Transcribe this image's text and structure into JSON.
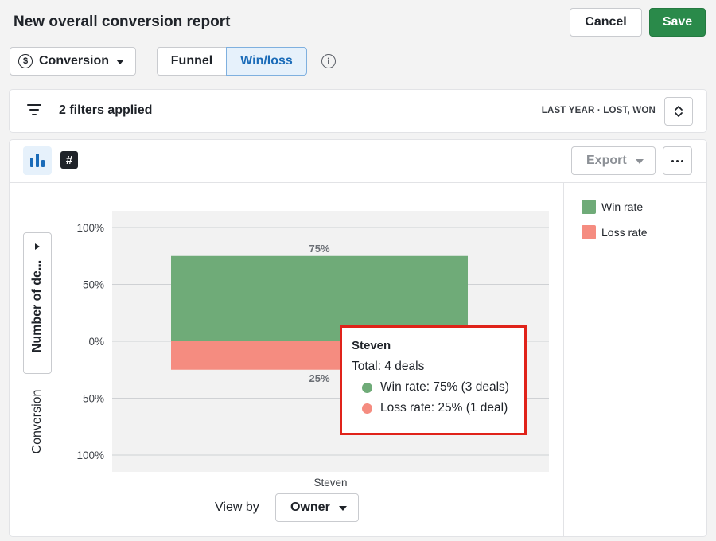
{
  "header": {
    "title": "New overall conversion report",
    "cancel_label": "Cancel",
    "save_label": "Save"
  },
  "toolbar": {
    "report_type": "Conversion",
    "segments": [
      "Funnel",
      "Win/loss"
    ],
    "active_segment": "Win/loss"
  },
  "filters": {
    "label": "2 filters applied",
    "summary": "LAST YEAR  ·  LOST, WON"
  },
  "panel": {
    "export_label": "Export",
    "vertical_dropdown_label": "Number of de...",
    "vertical_axis_label": "Conversion",
    "view_by_label": "View by",
    "view_by_value": "Owner"
  },
  "colors": {
    "win": "#6fab78",
    "loss": "#f58c80",
    "accent": "#1a6bb8",
    "save": "#2a8a4a",
    "highlight": "#e0231a"
  },
  "chart_data": {
    "type": "bar",
    "stacked": "diverging",
    "categories": [
      "Steven"
    ],
    "series": [
      {
        "name": "Win rate",
        "values": [
          75
        ],
        "color": "#6fab78",
        "label": "75%"
      },
      {
        "name": "Loss rate",
        "values": [
          -25
        ],
        "color": "#f58c80",
        "label": "25%"
      }
    ],
    "ylim": [
      -100,
      100
    ],
    "yticks": [
      {
        "value": 100,
        "label": "100%"
      },
      {
        "value": 50,
        "label": "50%"
      },
      {
        "value": 0,
        "label": "0%"
      },
      {
        "value": -50,
        "label": "50%"
      },
      {
        "value": -100,
        "label": "100%"
      }
    ],
    "grid": true,
    "legend": "right"
  },
  "tooltip": {
    "name": "Steven",
    "total": "Total: 4 deals",
    "rows": [
      {
        "text": "Win rate: 75% (3 deals)",
        "color": "#6fab78"
      },
      {
        "text": "Loss rate: 25% (1 deal)",
        "color": "#f58c80"
      }
    ]
  }
}
